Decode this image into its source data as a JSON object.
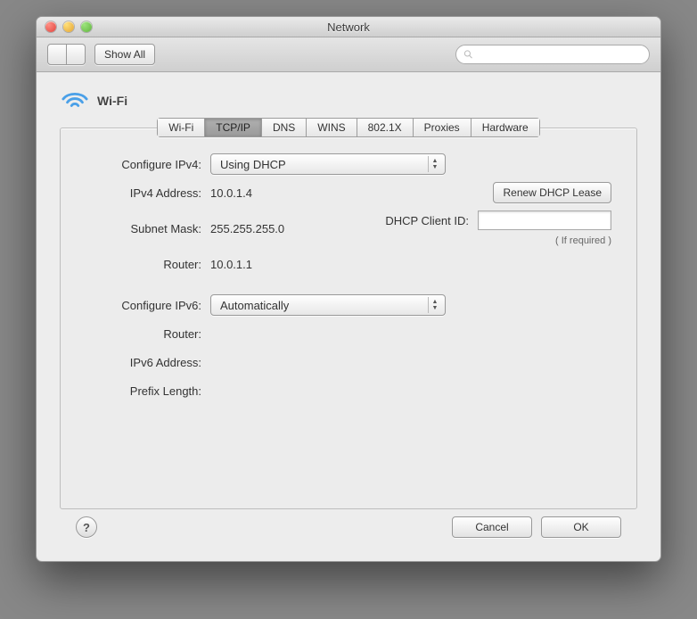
{
  "window": {
    "title": "Network"
  },
  "toolbar": {
    "show_all": "Show All",
    "search_placeholder": ""
  },
  "service": {
    "name": "Wi-Fi"
  },
  "tabs": {
    "wifi": "Wi-Fi",
    "tcpip": "TCP/IP",
    "dns": "DNS",
    "wins": "WINS",
    "8021x": "802.1X",
    "proxies": "Proxies",
    "hardware": "Hardware"
  },
  "labels": {
    "configure_ipv4": "Configure IPv4:",
    "ipv4_address": "IPv4 Address:",
    "subnet_mask": "Subnet Mask:",
    "router": "Router:",
    "configure_ipv6": "Configure IPv6:",
    "ipv6_router": "Router:",
    "ipv6_address": "IPv6 Address:",
    "prefix_length": "Prefix Length:",
    "dhcp_client_id": "DHCP Client ID:"
  },
  "values": {
    "configure_ipv4": "Using DHCP",
    "ipv4_address": "10.0.1.4",
    "subnet_mask": "255.255.255.0",
    "router": "10.0.1.1",
    "configure_ipv6": "Automatically",
    "ipv6_router": "",
    "ipv6_address": "",
    "prefix_length": "",
    "dhcp_client_id": ""
  },
  "buttons": {
    "renew_dhcp": "Renew DHCP Lease",
    "cancel": "Cancel",
    "ok": "OK"
  },
  "notes": {
    "if_required": "( If required )"
  }
}
